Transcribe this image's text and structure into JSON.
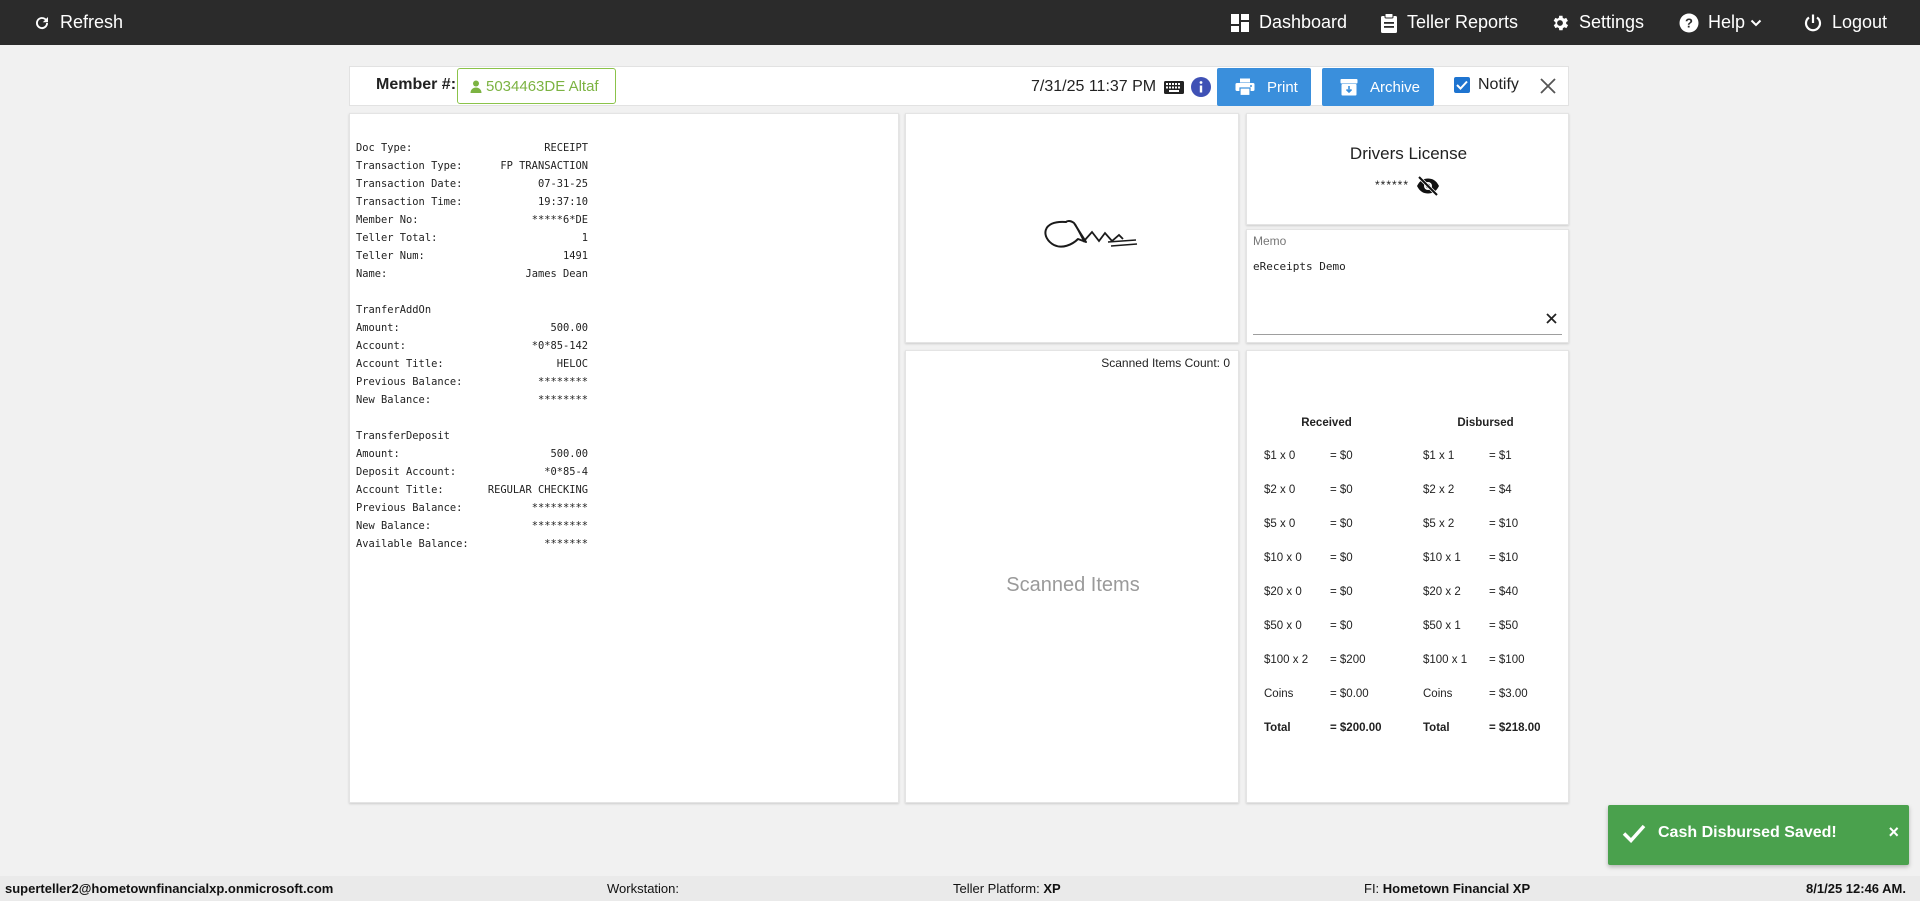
{
  "topbar": {
    "refresh": "Refresh",
    "dashboard": "Dashboard",
    "teller_reports": "Teller Reports",
    "settings": "Settings",
    "help": "Help",
    "logout": "Logout"
  },
  "header": {
    "member_label": "Member #:",
    "member_value": "5034463DE Altaf",
    "datetime": "7/31/25 11:37 PM",
    "print": "Print",
    "archive": "Archive",
    "notify": "Notify",
    "notify_checked": true
  },
  "receipt": {
    "lines": [
      {
        "k": "Doc Type:",
        "v": "RECEIPT"
      },
      {
        "k": "Transaction Type:",
        "v": "FP TRANSACTION"
      },
      {
        "k": "Transaction Date:",
        "v": "07-31-25"
      },
      {
        "k": "Transaction Time:",
        "v": "19:37:10"
      },
      {
        "k": "Member No:",
        "v": "*****6*DE"
      },
      {
        "k": "Teller Total:",
        "v": "1"
      },
      {
        "k": "Teller Num:",
        "v": "1491"
      },
      {
        "k": "Name:",
        "v": "James Dean"
      },
      {
        "k": "",
        "v": ""
      },
      {
        "k": "TranferAddOn",
        "v": ""
      },
      {
        "k": "Amount:",
        "v": "500.00"
      },
      {
        "k": "Account:",
        "v": "*0*85-142"
      },
      {
        "k": "Account Title:",
        "v": "HELOC"
      },
      {
        "k": "Previous Balance:",
        "v": "********"
      },
      {
        "k": "New Balance:",
        "v": "********"
      },
      {
        "k": "",
        "v": ""
      },
      {
        "k": "TransferDeposit",
        "v": ""
      },
      {
        "k": "Amount:",
        "v": "500.00"
      },
      {
        "k": "Deposit Account:",
        "v": "*0*85-4"
      },
      {
        "k": "Account Title:",
        "v": "REGULAR CHECKING"
      },
      {
        "k": "Previous Balance:",
        "v": "*********"
      },
      {
        "k": "New Balance:",
        "v": "*********"
      },
      {
        "k": "Available Balance:",
        "v": "*******"
      }
    ]
  },
  "scanned": {
    "count_label": "Scanned Items Count: 0",
    "title": "Scanned Items"
  },
  "license": {
    "title": "Drivers License",
    "value": "******"
  },
  "memo": {
    "label": "Memo",
    "value": "eReceipts Demo"
  },
  "cash": {
    "received_label": "Received",
    "disbursed_label": "Disbursed",
    "rows": [
      {
        "r_denom": "$1 x 0",
        "r_amt": "= $0",
        "d_denom": "$1 x 1",
        "d_amt": "= $1"
      },
      {
        "r_denom": "$2 x 0",
        "r_amt": "= $0",
        "d_denom": "$2 x 2",
        "d_amt": "= $4"
      },
      {
        "r_denom": "$5 x 0",
        "r_amt": "= $0",
        "d_denom": "$5 x 2",
        "d_amt": "= $10"
      },
      {
        "r_denom": "$10 x 0",
        "r_amt": "= $0",
        "d_denom": "$10 x 1",
        "d_amt": "= $10"
      },
      {
        "r_denom": "$20 x 0",
        "r_amt": "= $0",
        "d_denom": "$20 x 2",
        "d_amt": "= $40"
      },
      {
        "r_denom": "$50 x 0",
        "r_amt": "= $0",
        "d_denom": "$50 x 1",
        "d_amt": "= $50"
      },
      {
        "r_denom": "$100 x 2",
        "r_amt": "= $200",
        "d_denom": "$100 x 1",
        "d_amt": "= $100"
      },
      {
        "r_denom": "Coins",
        "r_amt": "= $0.00",
        "d_denom": "Coins",
        "d_amt": "= $3.00"
      }
    ],
    "total": {
      "r_label": "Total",
      "r_amt": "= $200.00",
      "d_label": "Total",
      "d_amt": "= $218.00"
    }
  },
  "toast": {
    "message": "Cash Disbursed Saved!",
    "close": "×"
  },
  "footer": {
    "user": "superteller2@hometownfinancialxp.onmicrosoft.com",
    "workstation_label": "Workstation:",
    "workstation_value": "",
    "platform_label": "Teller Platform:",
    "platform_value": "XP",
    "fi_label": "FI:",
    "fi_value": "Hometown Financial XP",
    "datetime": "8/1/25 12:46 AM."
  },
  "colors": {
    "topbar": "#2b2b2b",
    "primary_button": "#3a8fdc",
    "member_chip": "#8bc34a",
    "toast": "#4aa14d"
  }
}
